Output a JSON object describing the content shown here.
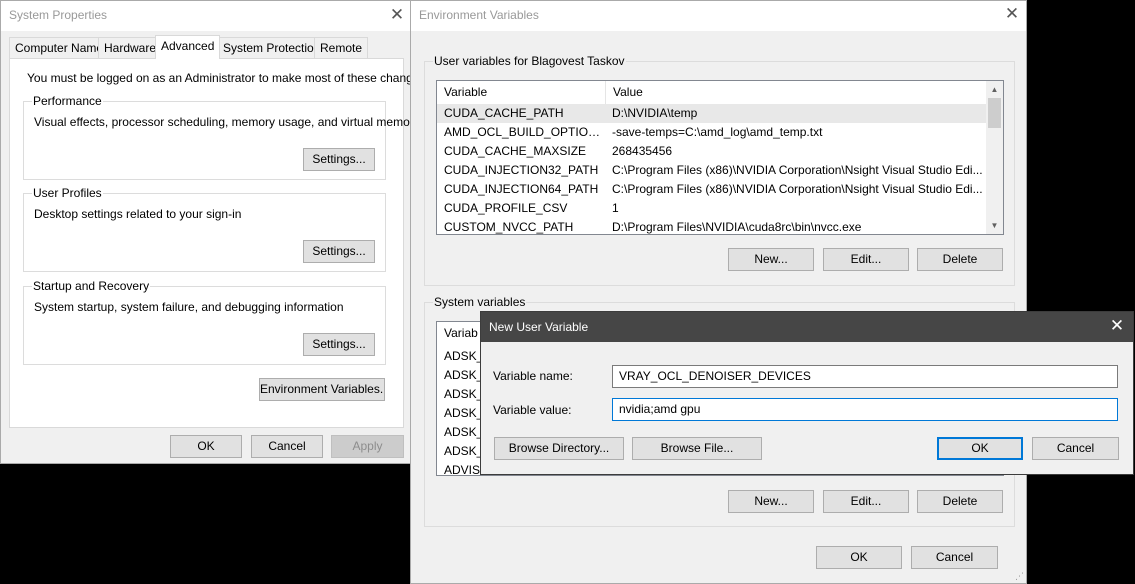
{
  "system_properties": {
    "title": "System Properties",
    "tabs": [
      "Computer Name",
      "Hardware",
      "Advanced",
      "System Protection",
      "Remote"
    ],
    "admin_note": "You must be logged on as an Administrator to make most of these changes.",
    "performance": {
      "label": "Performance",
      "desc": "Visual effects, processor scheduling, memory usage, and virtual memory",
      "button": "Settings..."
    },
    "user_profiles": {
      "label": "User Profiles",
      "desc": "Desktop settings related to your sign-in",
      "button": "Settings..."
    },
    "startup": {
      "label": "Startup and Recovery",
      "desc": "System startup, system failure, and debugging information",
      "button": "Settings..."
    },
    "env_button": "Environment Variables...",
    "ok": "OK",
    "cancel": "Cancel",
    "apply": "Apply"
  },
  "env_vars": {
    "title": "Environment Variables",
    "user_label": "User variables for Blagovest Taskov",
    "col_variable": "Variable",
    "col_value": "Value",
    "user_rows": [
      {
        "name": "CUDA_CACHE_PATH",
        "value": "D:\\NVIDIA\\temp"
      },
      {
        "name": "AMD_OCL_BUILD_OPTIONS...",
        "value": "-save-temps=C:\\amd_log\\amd_temp.txt"
      },
      {
        "name": "CUDA_CACHE_MAXSIZE",
        "value": "268435456"
      },
      {
        "name": "CUDA_INJECTION32_PATH",
        "value": "C:\\Program Files (x86)\\NVIDIA Corporation\\Nsight Visual Studio Edi..."
      },
      {
        "name": "CUDA_INJECTION64_PATH",
        "value": "C:\\Program Files (x86)\\NVIDIA Corporation\\Nsight Visual Studio Edi..."
      },
      {
        "name": "CUDA_PROFILE_CSV",
        "value": "1"
      },
      {
        "name": "CUSTOM_NVCC_PATH",
        "value": "D:\\Program Files\\NVIDIA\\cuda8rc\\bin\\nvcc.exe"
      }
    ],
    "new": "New...",
    "edit": "Edit...",
    "delete": "Delete",
    "system_label": "System variables",
    "sys_header": "Variab",
    "sys_rows": [
      "ADSK_",
      "ADSK_",
      "ADSK_",
      "ADSK_",
      "ADSK_",
      "ADSK_",
      "ADVISO"
    ],
    "ok": "OK",
    "cancel": "Cancel"
  },
  "new_user_variable": {
    "title": "New User Variable",
    "name_label": "Variable name:",
    "name_value": "VRAY_OCL_DENOISER_DEVICES",
    "value_label": "Variable value:",
    "value_value": "nvidia;amd gpu",
    "browse_dir": "Browse Directory...",
    "browse_file": "Browse File...",
    "ok": "OK",
    "cancel": "Cancel"
  }
}
